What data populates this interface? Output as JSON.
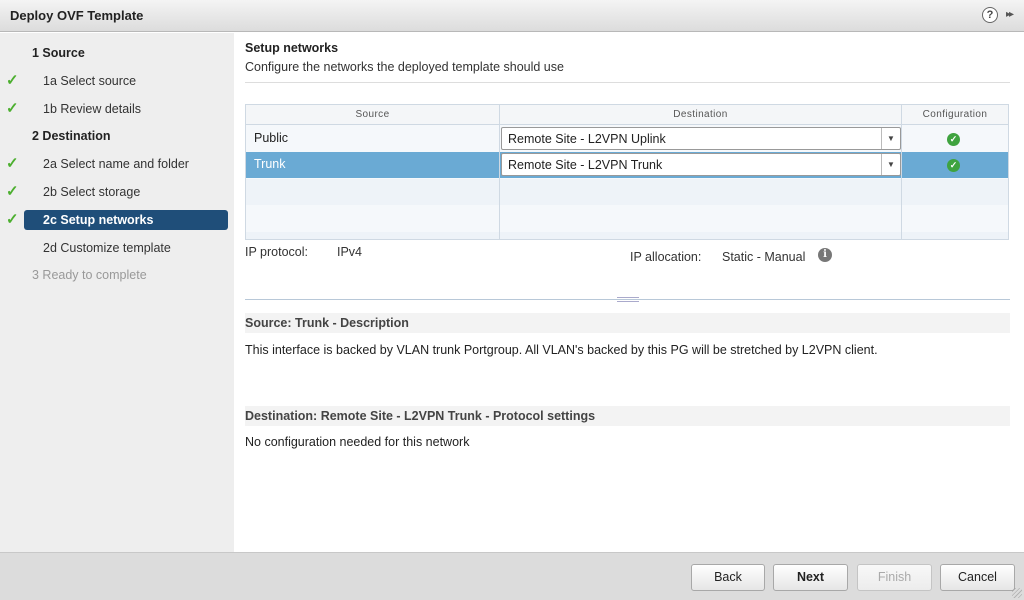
{
  "window": {
    "title": "Deploy OVF Template"
  },
  "steps": [
    {
      "label": "1  Source",
      "kind": "group",
      "done": false
    },
    {
      "label": "1a  Select source",
      "kind": "sub",
      "done": true
    },
    {
      "label": "1b  Review details",
      "kind": "sub",
      "done": true
    },
    {
      "label": "2  Destination",
      "kind": "group",
      "done": false
    },
    {
      "label": "2a  Select name and folder",
      "kind": "sub",
      "done": true
    },
    {
      "label": "2b  Select storage",
      "kind": "sub",
      "done": true
    },
    {
      "label": "2c  Setup networks",
      "kind": "sub",
      "done": true,
      "active": true
    },
    {
      "label": "2d  Customize template",
      "kind": "sub",
      "done": false
    },
    {
      "label": "3  Ready to complete",
      "kind": "disabled",
      "done": false
    }
  ],
  "main": {
    "heading": "Setup networks",
    "subheading": "Configure the networks the deployed template should use",
    "table": {
      "columns": [
        "Source",
        "Destination",
        "Configuration"
      ],
      "rows": [
        {
          "source": "Public",
          "destination": "Remote Site - L2VPN Uplink",
          "config": "ok",
          "selected": false
        },
        {
          "source": "Trunk",
          "destination": "Remote Site - L2VPN Trunk",
          "config": "ok",
          "selected": true
        }
      ]
    },
    "ip_protocol_label": "IP protocol:",
    "ip_protocol_value": "IPv4",
    "ip_allocation_label": "IP allocation:",
    "ip_allocation_value": "Static - Manual",
    "source_desc_heading": "Source: Trunk - Description",
    "source_desc_text": "This interface is backed by VLAN trunk Portgroup. All VLAN's backed by this PG will be stretched by L2VPN client.",
    "dest_heading": "Destination: Remote Site - L2VPN Trunk - Protocol settings",
    "dest_text": "No configuration needed for this network"
  },
  "footer": {
    "back": "Back",
    "next": "Next",
    "finish": "Finish",
    "cancel": "Cancel"
  },
  "icons": {
    "help": "?",
    "expand": "▸▸",
    "check": "✓",
    "info": "i"
  }
}
